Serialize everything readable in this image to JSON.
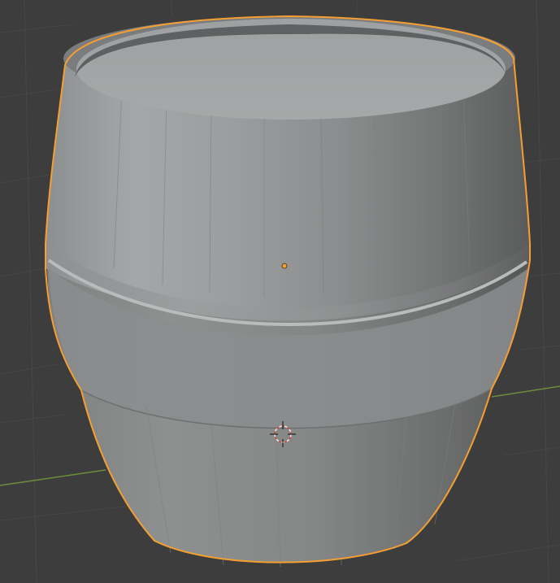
{
  "viewport": {
    "background_color": "#3d3d3d",
    "grid_line_color": "#4a4a4a",
    "x_axis_color": "#6b8f3a",
    "selection_outline_color": "#f59f32",
    "mesh_base_color": "#8a8a8a",
    "origin_point_color": "#f59f32"
  },
  "scene": {
    "selected_object_icon": "barrel-mesh",
    "origin_icon": "object-origin-dot-icon",
    "cursor_icon": "3d-cursor-icon",
    "gizmo": "none"
  }
}
